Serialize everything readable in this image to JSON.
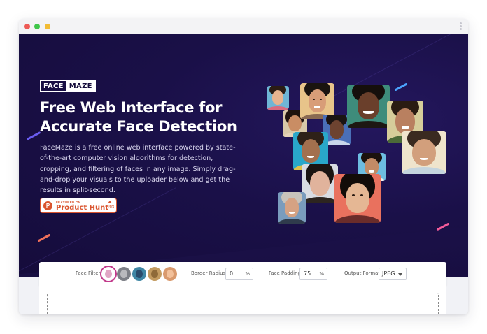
{
  "brand": {
    "logo_left": "FACE",
    "logo_right": "MAZE"
  },
  "hero": {
    "title": "Free Web Interface for Accurate Face Detection",
    "description": "FaceMaze is a free online web interface powered by state-of-the-art computer vision algorithms for detection, cropping, and filtering of faces in any image. Simply drag-and-drop your visuals to the uploader below and get the results in split-second."
  },
  "product_hunt": {
    "icon_letter": "P",
    "small_label": "FEATURED ON",
    "name": "Product Hunt",
    "count": "193"
  },
  "toolbar": {
    "face_filter_label": "Face Filter:",
    "border_radius_label": "Border Radius:",
    "border_radius_value": "0",
    "face_padding_label": "Face Padding:",
    "face_padding_value": "75",
    "unit": "%",
    "output_format_label": "Output Format:",
    "output_format_value": "JPEG"
  },
  "colors": {
    "hero_bg": "#150c3b",
    "product_hunt": "#da552f",
    "active_filter": "#c23a8b"
  },
  "icons": [
    "product-hunt-icon",
    "upvote-arrow-icon",
    "chevron-down-icon",
    "kebab-menu-icon"
  ]
}
